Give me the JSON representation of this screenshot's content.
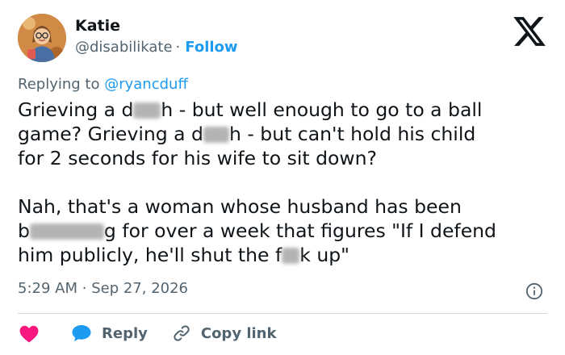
{
  "author": {
    "name": "Katie",
    "handle": "@disabilikate",
    "separator": "·",
    "follow_label": "Follow"
  },
  "reply_context": {
    "prefix": "Replying to",
    "mention": "@ryancduff"
  },
  "tweet": {
    "lines": [
      {
        "p1": "Grieving a d",
        "p2": "h - but well enough to go to a ball"
      },
      {
        "p1": "game?  Grieving a d",
        "p2": "h - but can't hold his child"
      },
      {
        "p1": "for 2 seconds for his wife to sit down?"
      },
      {
        "p1": "Nah, that's a woman whose husband has been"
      },
      {
        "p1": "b",
        "p2": "g for over a week that figures \"If I defend"
      },
      {
        "p1": "him publicly, he'll shut the f",
        "p2": "k up\""
      }
    ]
  },
  "meta": {
    "time": "5:29 AM",
    "separator": "·",
    "date": "Sep 27, 2026"
  },
  "actions": {
    "reply_label": "Reply",
    "copy_link_label": "Copy link"
  },
  "icons": {
    "brand": "x-logo-icon",
    "info": "info-icon",
    "like": "heart-icon",
    "reply": "speech-bubble-icon",
    "copy": "link-icon"
  },
  "colors": {
    "text": "#0f1419",
    "secondary": "#536471",
    "accent": "#1d9bf0",
    "like": "#f91880",
    "divider": "#cfd9de"
  }
}
